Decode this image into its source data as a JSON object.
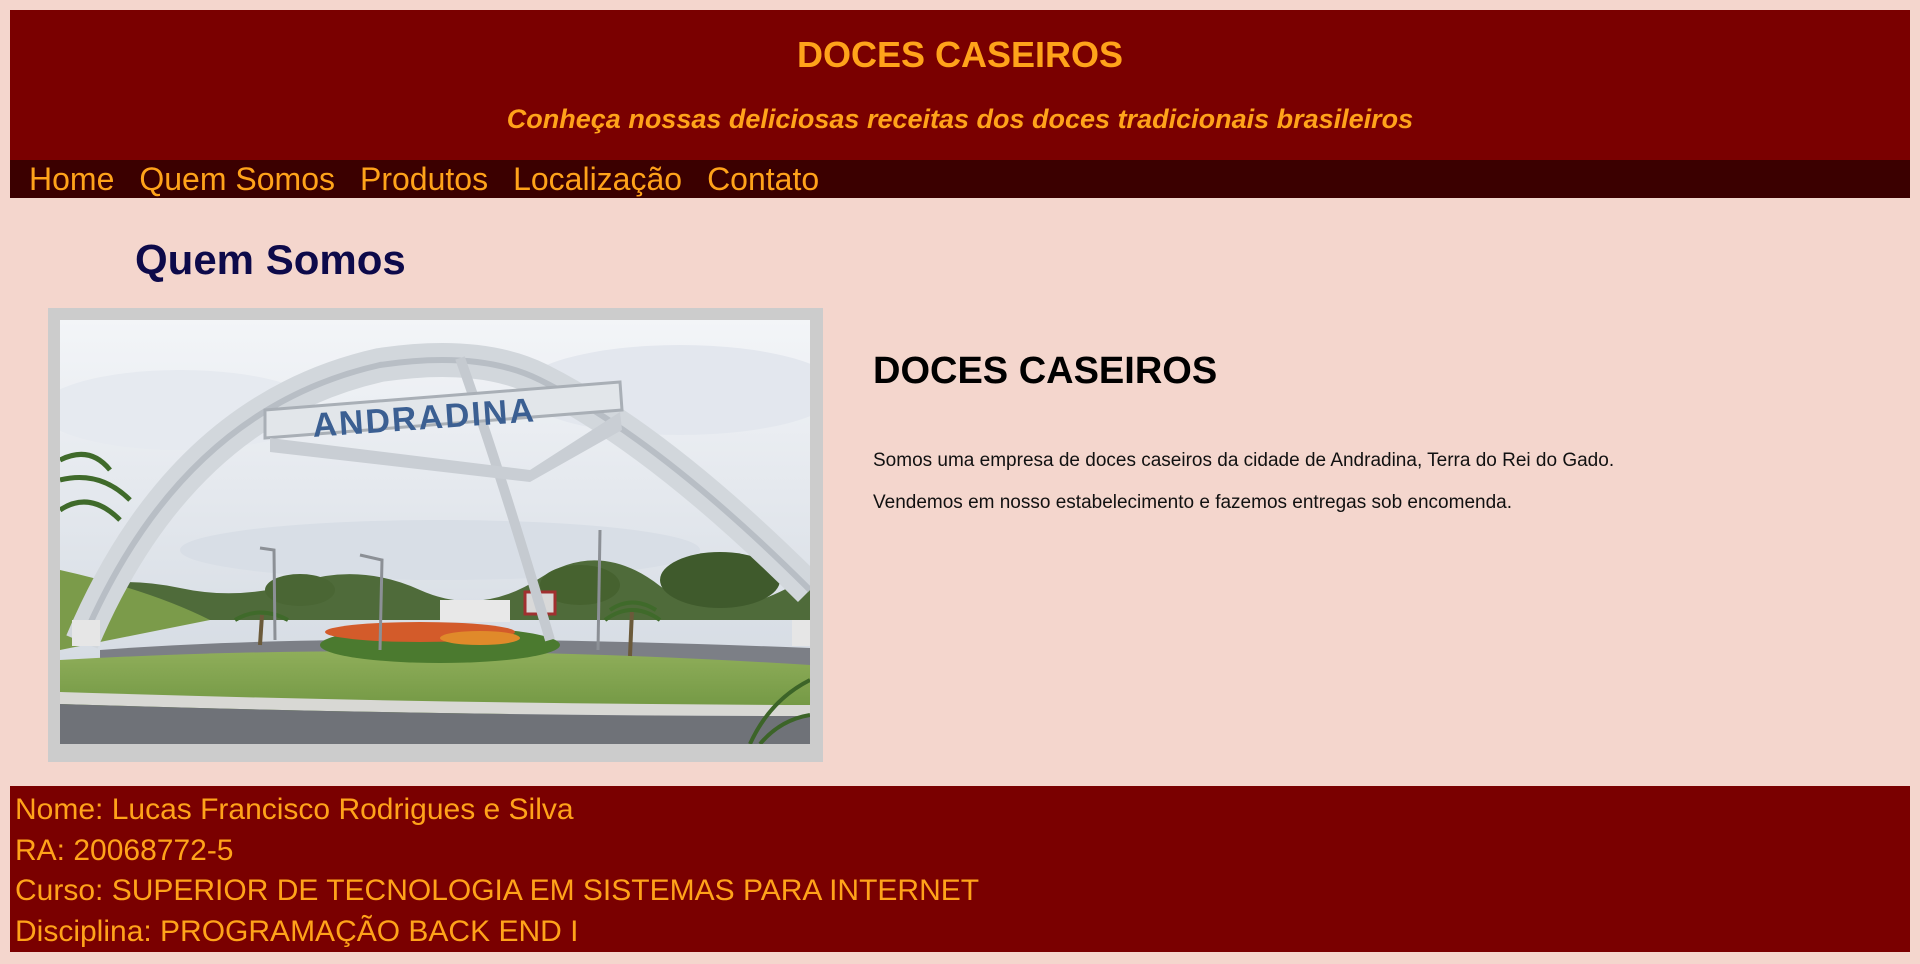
{
  "header": {
    "title": "DOCES CASEIROS",
    "tagline": "Conheça nossas deliciosas receitas dos doces tradicionais brasileiros"
  },
  "nav": {
    "items": [
      {
        "label": "Home"
      },
      {
        "label": "Quem Somos"
      },
      {
        "label": "Produtos"
      },
      {
        "label": "Localização"
      },
      {
        "label": "Contato"
      }
    ]
  },
  "main": {
    "section_title": "Quem Somos",
    "photo": {
      "sign_text": "ANDRADINA"
    },
    "content_title": "DOCES CASEIROS",
    "paragraphs": [
      "Somos uma empresa de doces caseiros da cidade de Andradina, Terra do Rei do Gado.",
      "Vendemos em nosso estabelecimento e fazemos entregas sob encomenda."
    ]
  },
  "footer": {
    "lines": [
      "Nome: Lucas Francisco Rodrigues e Silva",
      "RA: 20068772-5",
      "Curso: SUPERIOR DE TECNOLOGIA EM SISTEMAS PARA INTERNET",
      "Disciplina: PROGRAMAÇÃO BACK END I"
    ]
  },
  "colors": {
    "page_background": "#f4d6cd",
    "header_background": "#7a0000",
    "nav_background": "#3b0000",
    "accent_text": "#ffa31a",
    "section_title": "#0d0a4a"
  }
}
